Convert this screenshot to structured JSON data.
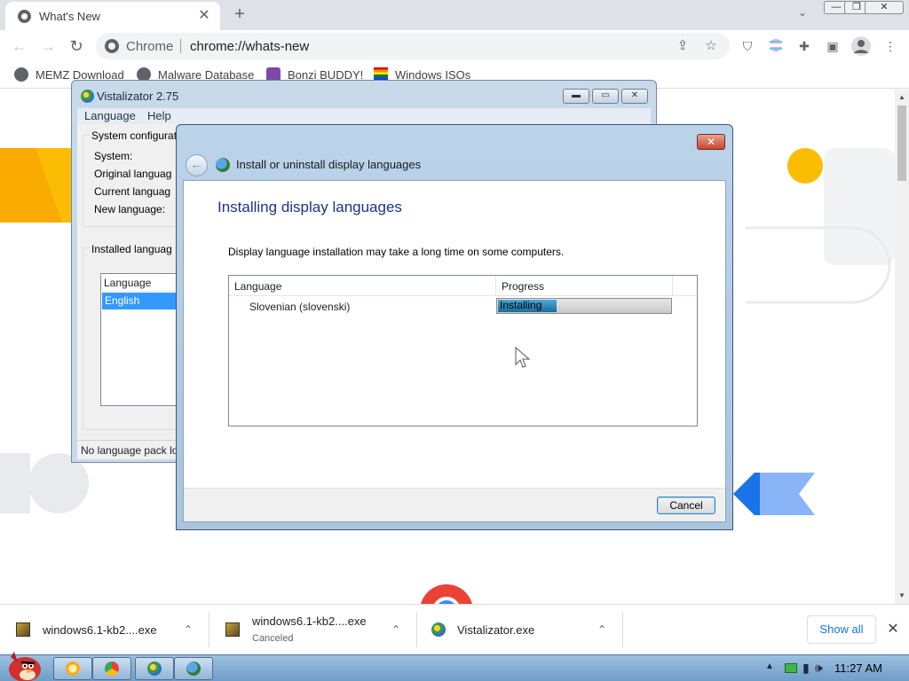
{
  "browser": {
    "tab_title": "What's New",
    "tab_close": "✕",
    "new_tab": "+",
    "omnibox_chip": "Chrome",
    "url": "chrome://whats-new",
    "window_controls": {
      "minimize": "—",
      "restore": "❐",
      "close": "✕"
    },
    "icons": [
      "back-icon",
      "forward-icon",
      "reload-icon",
      "share-icon",
      "bookmark-star-icon",
      "ublock-icon",
      "extensions-icon",
      "side-panel-icon",
      "profile-icon",
      "menu-icon"
    ]
  },
  "bookmarks": [
    {
      "label": "MEMZ Download"
    },
    {
      "label": "Malware Database"
    },
    {
      "label": "Bonzi BUDDY!"
    },
    {
      "label": "Windows ISOs"
    }
  ],
  "vistalizator": {
    "title": "Vistalizator 2.75",
    "menu": [
      "Language",
      "Help"
    ],
    "group_system": "System configurat",
    "labels": [
      "System:",
      "Original languag",
      "Current languag",
      "New language:"
    ],
    "group_installed": "Installed languag",
    "list_header": "Language",
    "list_selected": "English",
    "status": "No language pack lo"
  },
  "dialog": {
    "title": "Install or uninstall display languages",
    "heading": "Installing display languages",
    "description": "Display language installation may take a long time on some computers.",
    "columns": [
      "Language",
      "Progress"
    ],
    "row_language": "Slovenian (slovenski)",
    "progress_text": "Installing",
    "progress_fraction": 0.34,
    "cancel": "Cancel",
    "close": "✕"
  },
  "downloads": [
    {
      "name": "windows6.1-kb2....exe",
      "status": ""
    },
    {
      "name": "windows6.1-kb2....exe",
      "status": "Canceled"
    },
    {
      "name": "Vistalizator.exe",
      "status": ""
    }
  ],
  "shelf": {
    "show_all": "Show all",
    "close": "✕"
  },
  "taskbar": {
    "clock": "11:27 AM"
  },
  "colors": {
    "chrome_tabbar": "#dee1e6",
    "accent_blue": "#1a73e8",
    "aero": "#bcd4ea",
    "selection": "#3399ff"
  }
}
